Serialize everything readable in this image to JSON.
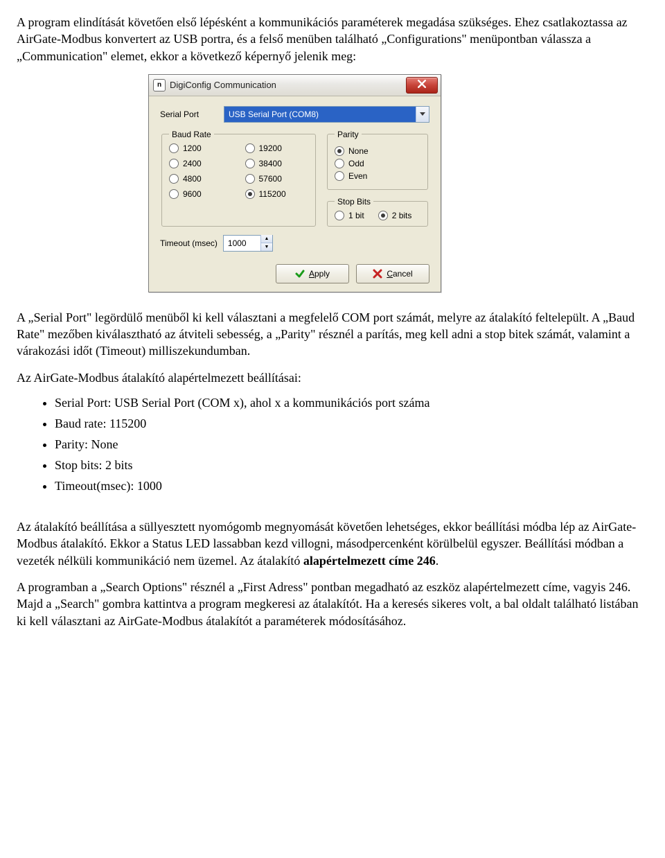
{
  "paragraphs": {
    "p1": "A program elindítását követően első lépésként a kommunikációs paraméterek megadása szükséges. Ehez csatlakoztassa az AirGate-Modbus konvertert az USB portra, és a felső menüben található „Configurations\" menüpontban válassza a „Communication\" elemet, ekkor a következő képernyő jelenik meg:",
    "p2": "A „Serial Port\" legördülő menüből ki kell választani a megfelelő COM port számát, melyre az átalakító feltelepült. A „Baud Rate\" mezőben kiválasztható az átviteli sebesség, a „Parity\" résznél a parítás, meg kell adni a stop bitek számát, valamint a várakozási időt (Timeout) milliszekundumban.",
    "p3": "Az AirGate-Modbus átalakító alapértelmezett beállításai:",
    "p4_a": "Az átalakító beállítása a süllyesztett nyomógomb megnyomását követően lehetséges, ekkor beállítási módba lép az AirGate-Modbus átalakító. Ekkor a Status LED lassabban kezd villogni, másodpercenként körülbelül egyszer. Beállítási módban a vezeték nélküli kommunikáció nem üzemel. Az átalakító ",
    "p4_b": "alapértelmezett címe 246",
    "p4_c": ".",
    "p5": "A programban a „Search Options\" résznél a „First Adress\" pontban megadható az eszköz alapértelmezett címe, vagyis 246. Majd a „Search\" gombra kattintva a program megkeresi az átalakítót. Ha a keresés sikeres volt, a bal oldalt található listában ki kell választani az AirGate-Modbus átalakítót a paraméterek módosításához."
  },
  "bullets": [
    "Serial Port: USB Serial Port (COM x), ahol x a kommunikációs port száma",
    "Baud rate: 115200",
    "Parity: None",
    "Stop bits: 2 bits",
    "Timeout(msec): 1000"
  ],
  "dialog": {
    "title": "DigiConfig Communication",
    "app_icon_letter": "n",
    "labels": {
      "serial_port": "Serial Port",
      "baud_rate": "Baud Rate",
      "parity": "Parity",
      "stop_bits": "Stop Bits",
      "timeout": "Timeout (msec)"
    },
    "serial_port_value": "USB Serial Port (COM8)",
    "baud_options": [
      "1200",
      "2400",
      "4800",
      "9600",
      "19200",
      "38400",
      "57600",
      "115200"
    ],
    "baud_selected": "115200",
    "parity_options": [
      "None",
      "Odd",
      "Even"
    ],
    "parity_selected": "None",
    "stop_options": [
      "1 bit",
      "2 bits"
    ],
    "stop_selected": "2 bits",
    "timeout_value": "1000",
    "buttons": {
      "apply": "Apply",
      "cancel": "Cancel"
    }
  }
}
